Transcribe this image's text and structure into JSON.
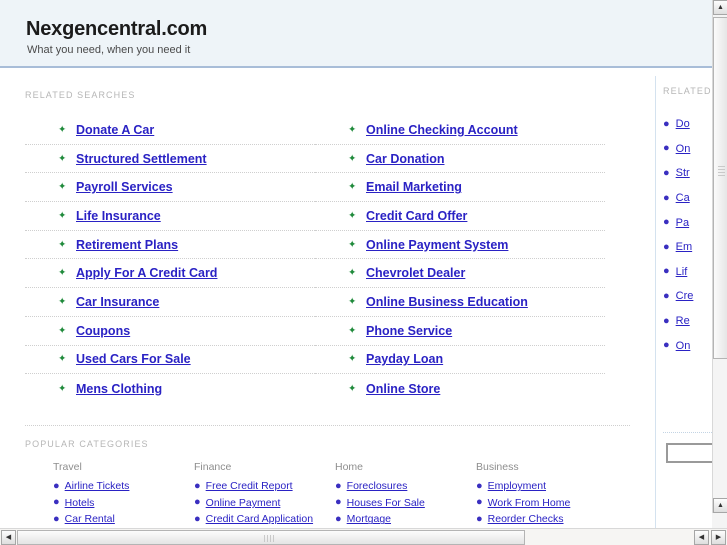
{
  "header": {
    "title": "Nexgencentral.com",
    "tagline": "What you need, when you need it"
  },
  "related": {
    "caption": "RELATED SEARCHES",
    "bullet_glyph": "✦",
    "columns": [
      {
        "items": [
          "Donate A Car",
          "Structured Settlement",
          "Payroll Services",
          "Life Insurance",
          "Retirement Plans",
          "Apply For A Credit Card",
          "Car Insurance",
          "Coupons",
          "Used Cars For Sale",
          "Mens Clothing"
        ]
      },
      {
        "items": [
          "Online Checking Account",
          "Car Donation",
          "Email Marketing",
          "Credit Card Offer",
          "Online Payment System",
          "Chevrolet Dealer",
          "Online Business Education",
          "Phone Service",
          "Payday Loan",
          "Online Store"
        ]
      }
    ]
  },
  "sidebar": {
    "caption": "RELATED",
    "bullet_glyph": "●",
    "items": [
      "Do",
      "On",
      "Str",
      "Ca",
      "Pa",
      "Em",
      "Lif",
      "Cre",
      "Re",
      "On"
    ],
    "search_value": "",
    "search_placeholder": ""
  },
  "categories": {
    "caption": "POPULAR CATEGORIES",
    "bullet_glyph": "●",
    "columns": [
      {
        "title": "Travel",
        "items": [
          "Airline Tickets",
          "Hotels",
          "Car Rental"
        ]
      },
      {
        "title": "Finance",
        "items": [
          "Free Credit Report",
          "Online Payment",
          "Credit Card Application"
        ]
      },
      {
        "title": "Home",
        "items": [
          "Foreclosures",
          "Houses For Sale",
          "Mortgage"
        ]
      },
      {
        "title": "Business",
        "items": [
          "Employment",
          "Work From Home",
          "Reorder Checks"
        ]
      }
    ]
  },
  "scrollbars": {
    "up_arrow": "▲",
    "down_arrow": "▼",
    "left_arrow": "◀",
    "right_arrow": "▶"
  },
  "colors": {
    "link": "#2a22c4",
    "arrow_bullet": "#1f8a3b",
    "header_bg": "#eef4f8",
    "header_border": "#a8bdd8",
    "caption": "#b6b6b6"
  }
}
